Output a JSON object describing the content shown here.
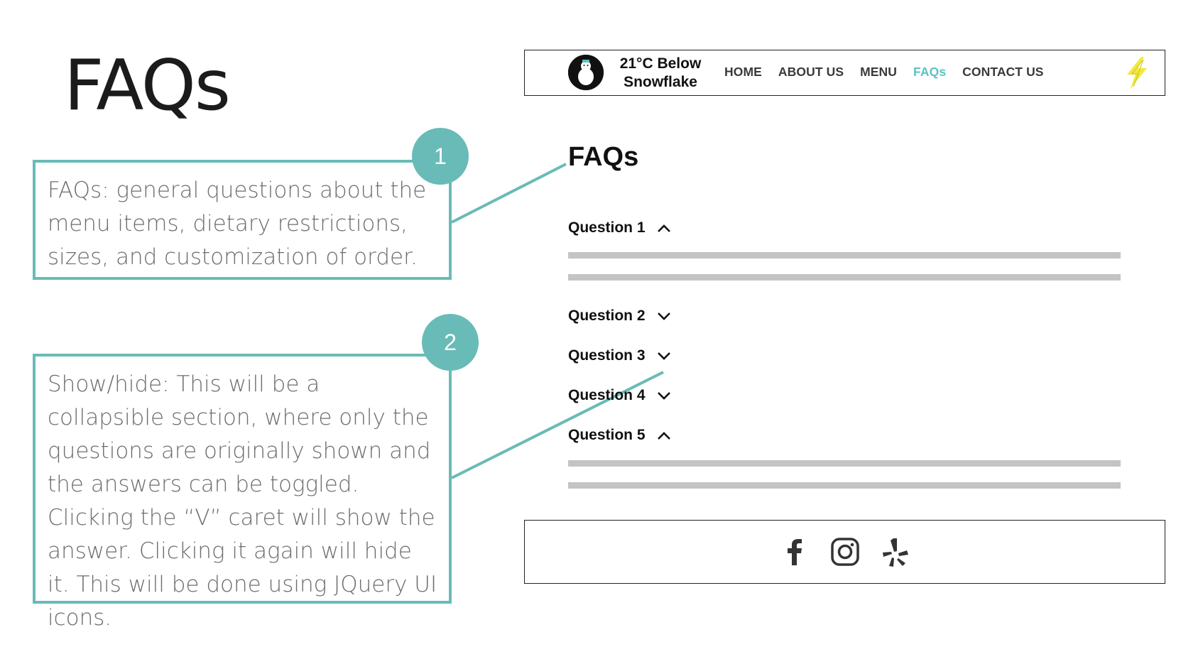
{
  "slide": {
    "title": "FAQs",
    "annotations": [
      {
        "number": "1",
        "text": "FAQs: general questions about the menu items, dietary restrictions, sizes, and customization of order."
      },
      {
        "number": "2",
        "text": "Show/hide: This will be a collapsible section, where only the questions are originally shown and the answers can be toggled. Clicking the “V” caret will show the answer. Clicking it again will hide it. This will be done using JQuery UI icons."
      }
    ],
    "accent_color": "#69bbb7"
  },
  "mockup": {
    "header": {
      "brand_line1": "21°C Below",
      "brand_line2": "Snowflake",
      "logo_icon": "snowman-logo-icon",
      "nav": [
        {
          "label": "HOME",
          "active": false
        },
        {
          "label": "ABOUT US",
          "active": false
        },
        {
          "label": "MENU",
          "active": false
        },
        {
          "label": "FAQs",
          "active": true
        },
        {
          "label": "CONTACT US",
          "active": false
        }
      ],
      "active_color": "#5bc3c0",
      "bolt_icon": "lightning-bolt-icon",
      "bolt_color": "#f2ea3a"
    },
    "faq": {
      "heading": "FAQs",
      "questions": [
        {
          "label": "Question 1",
          "caret": "up",
          "expanded": true
        },
        {
          "label": "Question 2",
          "caret": "down",
          "expanded": false
        },
        {
          "label": "Question 3",
          "caret": "down",
          "expanded": false
        },
        {
          "label": "Question 4",
          "caret": "down",
          "expanded": false
        },
        {
          "label": "Question 5",
          "caret": "up",
          "expanded": true
        }
      ]
    },
    "footer": {
      "icons": [
        "facebook-icon",
        "instagram-icon",
        "yelp-icon"
      ]
    }
  }
}
